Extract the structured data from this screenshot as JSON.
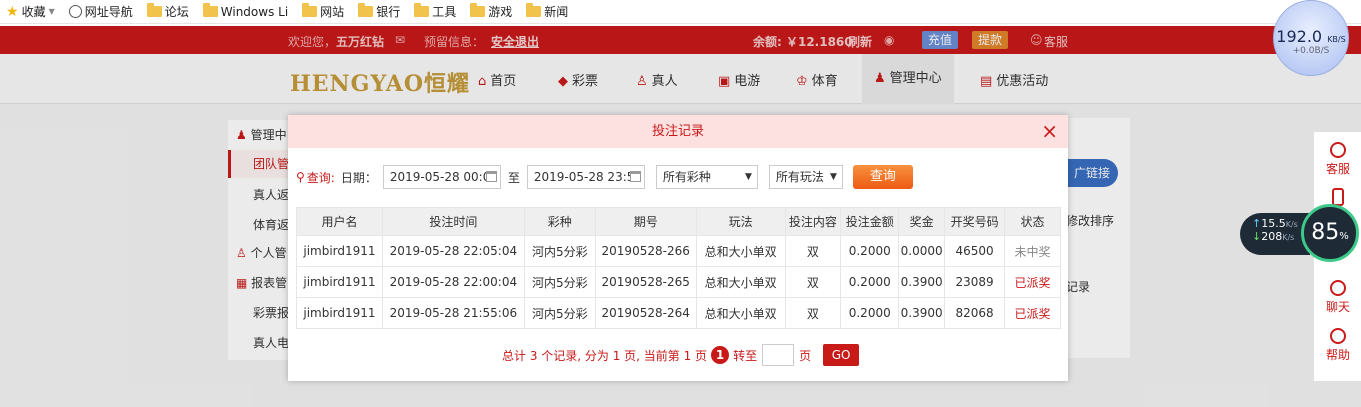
{
  "bookmarks": [
    {
      "label": "收藏",
      "icon": "star-icon"
    },
    {
      "label": "网址导航",
      "icon": "globe-icon"
    },
    {
      "label": "论坛",
      "icon": "folder-icon"
    },
    {
      "label": "Windows Li",
      "icon": "folder-icon"
    },
    {
      "label": "网站",
      "icon": "folder-icon"
    },
    {
      "label": "银行",
      "icon": "folder-icon"
    },
    {
      "label": "工具",
      "icon": "folder-icon"
    },
    {
      "label": "游戏",
      "icon": "folder-icon"
    },
    {
      "label": "新闻",
      "icon": "folder-icon"
    }
  ],
  "topbar": {
    "welcome": "欢迎您，",
    "username": "五万红钻",
    "notice_label": "预留信息：",
    "logout": "安全退出",
    "balance": "余额: ￥12.1860",
    "refresh": "刷新",
    "deposit": "充值",
    "withdraw": "提款",
    "service": "客服"
  },
  "navbar": {
    "logo": "HENGYAO恒耀",
    "items": [
      "首页",
      "彩票",
      "真人",
      "电游",
      "体育",
      "管理中心",
      "优惠活动"
    ]
  },
  "left_menu": [
    "管理中",
    "团队管",
    "真人返",
    "体育返",
    "个人管",
    "报表管",
    "彩票报",
    "真人电"
  ],
  "right_panel": {
    "link_btn": "广链接",
    "text1": "修改排序",
    "text2": "记录"
  },
  "modal": {
    "title": "投注记录",
    "close": "×",
    "query_label": "查询:",
    "date_label": "日期：",
    "date_from": "2019-05-28 00:0",
    "to_label": "至",
    "date_to": "2019-05-28 23:5",
    "lottery_select": "所有彩种",
    "play_select": "所有玩法",
    "query_btn": "查询",
    "columns": [
      "用户名",
      "投注时间",
      "彩种",
      "期号",
      "玩法",
      "投注内容",
      "投注金额",
      "奖金",
      "开奖号码",
      "状态"
    ],
    "rows": [
      [
        "jimbird1911",
        "2019-05-28 22:05:04",
        "河内5分彩",
        "20190528-266",
        "总和大小单双",
        "双",
        "0.2000",
        "0.0000",
        "46500",
        "未中奖"
      ],
      [
        "jimbird1911",
        "2019-05-28 22:00:04",
        "河内5分彩",
        "20190528-265",
        "总和大小单双",
        "双",
        "0.2000",
        "0.3900",
        "23089",
        "已派奖"
      ],
      [
        "jimbird1911",
        "2019-05-28 21:55:06",
        "河内5分彩",
        "20190528-264",
        "总和大小单双",
        "双",
        "0.2000",
        "0.3900",
        "82068",
        "已派奖"
      ]
    ],
    "pager": {
      "summary": "总计 3 个记录, 分为 1 页, 当前第 1 页",
      "current": "1",
      "goto": "转至",
      "page_unit": "页",
      "go": "GO"
    }
  },
  "widgets": {
    "speed_value": "192.0",
    "speed_unit": "KB/S",
    "speed_sub": "+0.0B/S",
    "up_rate": "15.5",
    "down_rate": "208",
    "rate_unit": "K/s",
    "percent": "85",
    "percent_sign": "%"
  },
  "sidebar_right": [
    "客服",
    "聊天",
    "帮助"
  ]
}
